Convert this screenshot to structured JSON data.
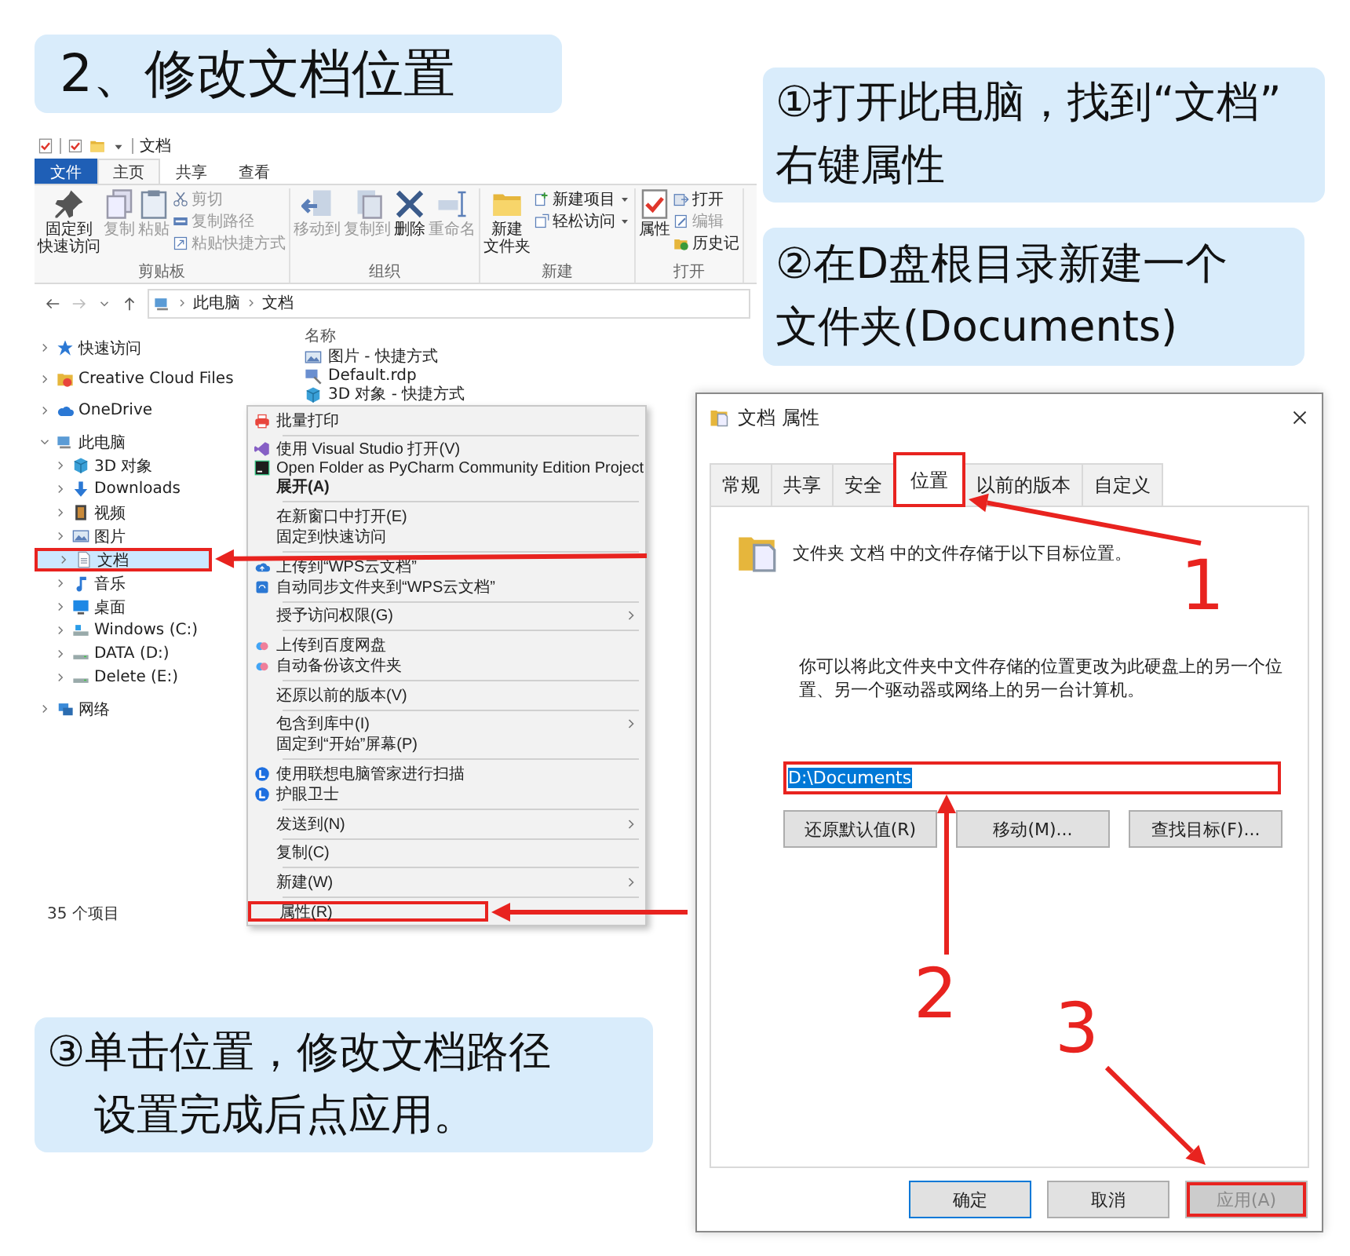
{
  "headline": "2、修改文档位置",
  "callouts": [
    {
      "lines": [
        "①打开此电脑，找到“文档”",
        "右键属性"
      ]
    },
    {
      "lines": [
        "②在D盘根目录新建一个",
        "文件夹(Documents)"
      ]
    },
    {
      "lines": [
        "③单击位置，修改文档路径",
        "设置完成后点应用。"
      ]
    }
  ],
  "explorer": {
    "title": "文档",
    "tabs": [
      {
        "label": "文件",
        "kind": "file",
        "selected": false
      },
      {
        "label": "主页",
        "kind": "tab",
        "selected": true
      },
      {
        "label": "共享",
        "kind": "tab",
        "selected": false
      },
      {
        "label": "查看",
        "kind": "tab",
        "selected": false
      }
    ],
    "ribbon": [
      {
        "label": "剪贴板",
        "items": [
          {
            "kind": "large",
            "lines": [
              "固定到",
              "快速访问"
            ],
            "disabled": false
          },
          {
            "kind": "large",
            "lines": [
              "复制"
            ],
            "disabled": true
          },
          {
            "kind": "large",
            "lines": [
              "粘贴"
            ],
            "disabled": true
          },
          {
            "kind": "small",
            "label": "剪切",
            "disabled": true
          },
          {
            "kind": "small",
            "label": "复制路径",
            "disabled": true
          },
          {
            "kind": "small",
            "label": "粘贴快捷方式",
            "disabled": true
          }
        ]
      },
      {
        "label": "组织",
        "items": [
          {
            "kind": "large",
            "lines": [
              "移动到"
            ],
            "disabled": true
          },
          {
            "kind": "large",
            "lines": [
              "复制到"
            ],
            "disabled": true
          },
          {
            "kind": "large",
            "lines": [
              "删除"
            ],
            "disabled": false
          },
          {
            "kind": "large",
            "lines": [
              "重命名"
            ],
            "disabled": true
          }
        ]
      },
      {
        "label": "新建",
        "items": [
          {
            "kind": "large",
            "lines": [
              "新建",
              "文件夹"
            ],
            "disabled": false
          },
          {
            "kind": "small",
            "label": "新建项目",
            "dropdown": true,
            "disabled": false
          },
          {
            "kind": "small",
            "label": "轻松访问",
            "dropdown": true,
            "disabled": false
          }
        ]
      },
      {
        "label": "打开",
        "items": [
          {
            "kind": "large",
            "lines": [
              "属性"
            ],
            "disabled": false
          },
          {
            "kind": "small",
            "label": "打开",
            "disabled": false
          },
          {
            "kind": "small",
            "label": "编辑",
            "disabled": true
          },
          {
            "kind": "small",
            "label": "历史记",
            "disabled": false
          }
        ]
      }
    ],
    "path": [
      "此电脑",
      "文档"
    ],
    "nav": [
      {
        "label": "快速访问",
        "expanded": false,
        "selected": false
      },
      {
        "label": "Creative Cloud Files",
        "expanded": false,
        "selected": false
      },
      {
        "label": "OneDrive",
        "expanded": false,
        "selected": false
      },
      {
        "label": "此电脑",
        "expanded": true,
        "selected": false,
        "children": [
          {
            "label": "3D 对象",
            "selected": false
          },
          {
            "label": "Downloads",
            "selected": false
          },
          {
            "label": "视频",
            "selected": false
          },
          {
            "label": "图片",
            "selected": false
          },
          {
            "label": "文档",
            "selected": true,
            "highlighted": true
          },
          {
            "label": "音乐",
            "selected": false
          },
          {
            "label": "桌面",
            "selected": false
          },
          {
            "label": "Windows (C:)",
            "selected": false
          },
          {
            "label": "DATA (D:)",
            "selected": false
          },
          {
            "label": "Delete (E:)",
            "selected": false
          }
        ]
      },
      {
        "label": "网络",
        "expanded": false,
        "selected": false
      }
    ],
    "column_header": "名称",
    "files": [
      "图片 - 快捷方式",
      "Default.rdp",
      "3D 对象 - 快捷方式"
    ],
    "status": "35 个项目"
  },
  "context_menu": [
    {
      "kind": "item",
      "label": "批量打印"
    },
    {
      "kind": "separator"
    },
    {
      "kind": "item",
      "label": "使用 Visual Studio 打开(V)"
    },
    {
      "kind": "item",
      "label": "Open Folder as PyCharm Community Edition Project"
    },
    {
      "kind": "item",
      "label": "展开(A)",
      "bold": true
    },
    {
      "kind": "separator"
    },
    {
      "kind": "item",
      "label": "在新窗口中打开(E)"
    },
    {
      "kind": "item",
      "label": "固定到快速访问"
    },
    {
      "kind": "separator"
    },
    {
      "kind": "item",
      "label": "上传到“WPS云文档”"
    },
    {
      "kind": "item",
      "label": "自动同步文件夹到“WPS云文档”"
    },
    {
      "kind": "separator"
    },
    {
      "kind": "item",
      "label": "授予访问权限(G)",
      "submenu": true
    },
    {
      "kind": "separator"
    },
    {
      "kind": "item",
      "label": "上传到百度网盘"
    },
    {
      "kind": "item",
      "label": "自动备份该文件夹"
    },
    {
      "kind": "separator"
    },
    {
      "kind": "item",
      "label": "还原以前的版本(V)"
    },
    {
      "kind": "separator"
    },
    {
      "kind": "item",
      "label": "包含到库中(I)",
      "submenu": true
    },
    {
      "kind": "item",
      "label": "固定到“开始”屏幕(P)"
    },
    {
      "kind": "separator"
    },
    {
      "kind": "item",
      "label": "使用联想电脑管家进行扫描"
    },
    {
      "kind": "item",
      "label": "护眼卫士"
    },
    {
      "kind": "separator"
    },
    {
      "kind": "item",
      "label": "发送到(N)",
      "submenu": true
    },
    {
      "kind": "separator"
    },
    {
      "kind": "item",
      "label": "复制(C)"
    },
    {
      "kind": "separator"
    },
    {
      "kind": "item",
      "label": "新建(W)",
      "submenu": true
    },
    {
      "kind": "separator"
    },
    {
      "kind": "item",
      "label": "属性(R)",
      "highlighted": true
    }
  ],
  "dialog": {
    "title": "文档 属性",
    "tabs": [
      {
        "label": "常规",
        "selected": false
      },
      {
        "label": "共享",
        "selected": false
      },
      {
        "label": "安全",
        "selected": false
      },
      {
        "label": "位置",
        "selected": true,
        "highlighted": true
      },
      {
        "label": "以前的版本",
        "selected": false
      },
      {
        "label": "自定义",
        "selected": false
      }
    ],
    "location_note": "文件夹 文档 中的文件存储于以下目标位置。",
    "description": "你可以将此文件夹中文件存储的位置更改为此硬盘上的另一个位置、另一个驱动器或网络上的另一台计算机。",
    "path_field": {
      "value": "D:\\Documents",
      "highlighted": true
    },
    "path_buttons": [
      "还原默认值(R)",
      "移动(M)...",
      "查找目标(F)..."
    ],
    "footer_buttons": [
      {
        "label": "确定",
        "kind": "default",
        "disabled": false
      },
      {
        "label": "取消",
        "kind": "normal",
        "disabled": false
      },
      {
        "label": "应用(A)",
        "kind": "normal",
        "disabled": true,
        "highlighted": true
      }
    ]
  },
  "steps": [
    "1",
    "2",
    "3"
  ]
}
